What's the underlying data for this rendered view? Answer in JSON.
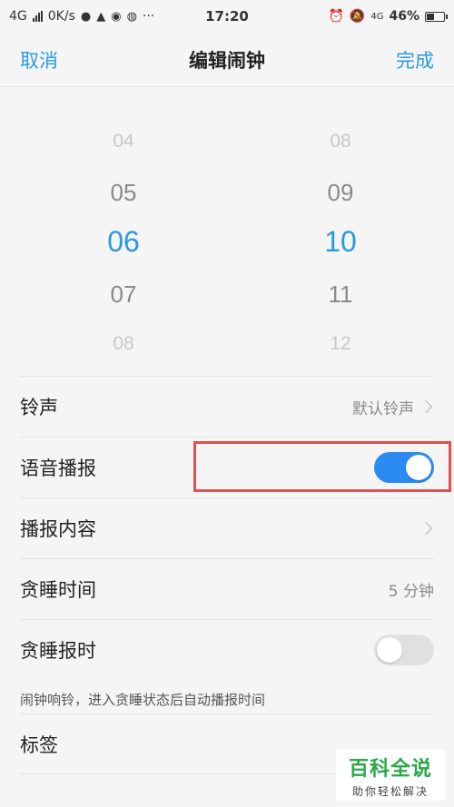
{
  "status_bar": {
    "network": "4G",
    "speed": "0K/s",
    "dots": "···",
    "time": "17:20",
    "network2": "4G",
    "battery": "46%",
    "battery_level": 0.46,
    "icons": [
      "wechat-icon",
      "qq-icon",
      "browser-icon",
      "weibo-icon",
      "alarm-icon",
      "mute-icon",
      "signal-icon",
      "battery-icon"
    ]
  },
  "nav": {
    "cancel": "取消",
    "title": "编辑闹钟",
    "done": "完成"
  },
  "picker": {
    "hours": [
      "04",
      "05",
      "06",
      "07",
      "08"
    ],
    "minutes": [
      "08",
      "09",
      "10",
      "11",
      "12"
    ],
    "selected_hour": "06",
    "selected_minute": "10"
  },
  "settings": {
    "ringtone": {
      "label": "铃声",
      "value": "默认铃声"
    },
    "voice_broadcast": {
      "label": "语音播报",
      "enabled": true
    },
    "broadcast_content": {
      "label": "播报内容"
    },
    "snooze_time": {
      "label": "贪睡时间",
      "value": "5 分钟"
    },
    "snooze_broadcast": {
      "label": "贪睡报时",
      "enabled": false
    },
    "note": "闹钟响铃，进入贪睡状态后自动播报时间",
    "tag": {
      "label": "标签"
    }
  },
  "watermark": {
    "title": "百科全说",
    "subtitle": "助你轻松解决"
  },
  "colors": {
    "accent": "#2a9ae0",
    "toggle_on": "#2a8cf0",
    "highlight": "#e05050"
  }
}
